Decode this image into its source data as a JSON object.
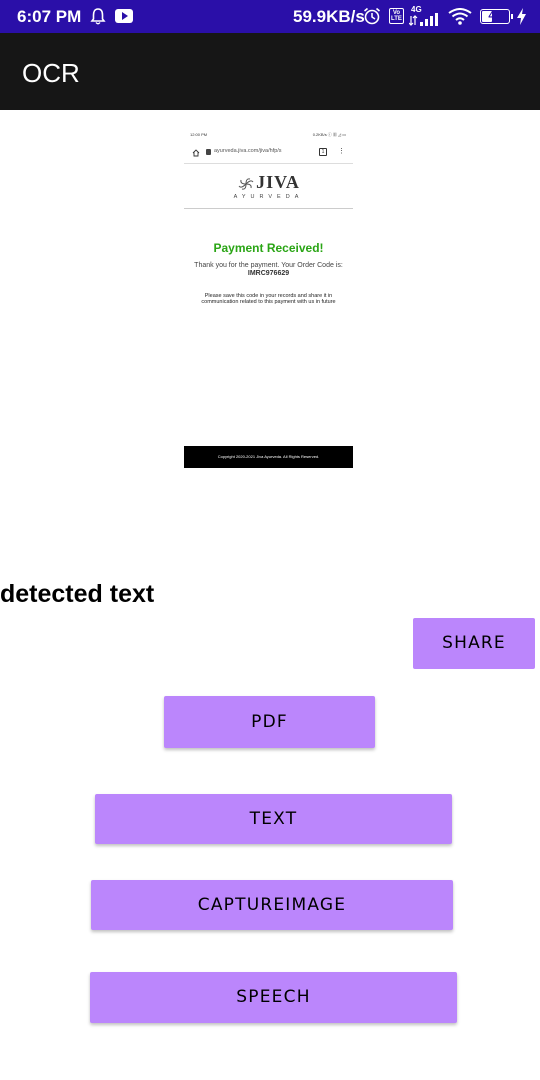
{
  "status_bar": {
    "time": "6:07 PM",
    "speed": "59.9KB/s",
    "volte": "Vo LTE",
    "network": "4G",
    "battery": "41",
    "battery_level": 0.41,
    "icons": [
      "bell-icon",
      "youtube-icon",
      "alarm-icon",
      "signal-icon",
      "wifi-icon",
      "battery-icon",
      "charging-icon"
    ]
  },
  "app_bar": {
    "title": "OCR"
  },
  "captured_image": {
    "status_time": "12:00 PM",
    "status_right": "0.2KB/s ⓘ ▦ ◿ ▭",
    "url": "ayurveda.jiva.com/jiva/hfp/s",
    "tab_count": "1",
    "logo_text": "JIVA",
    "logo_sub": "AYURVEDA",
    "heading": "Payment Received!",
    "thanks_text": "Thank you for the payment. Your Order Code is:",
    "order_code": "IMRC976629",
    "note": "Please save this code in your records and share it in communication related to this payment with us in future",
    "footer": "Copyright 2020-2021 Jiva Ayurveda. All Rights Reserved.",
    "heading_color": "#2aa515"
  },
  "detected_text_label": "detected text",
  "buttons": {
    "share": "SHARE",
    "pdf": "PDF",
    "text": "TEXT",
    "capture": "CAPTUREIMAGE",
    "speech": "SPEECH"
  },
  "colors": {
    "status_bar": "#2a0fa8",
    "app_bar": "#161616",
    "button": "#bb86fc"
  }
}
